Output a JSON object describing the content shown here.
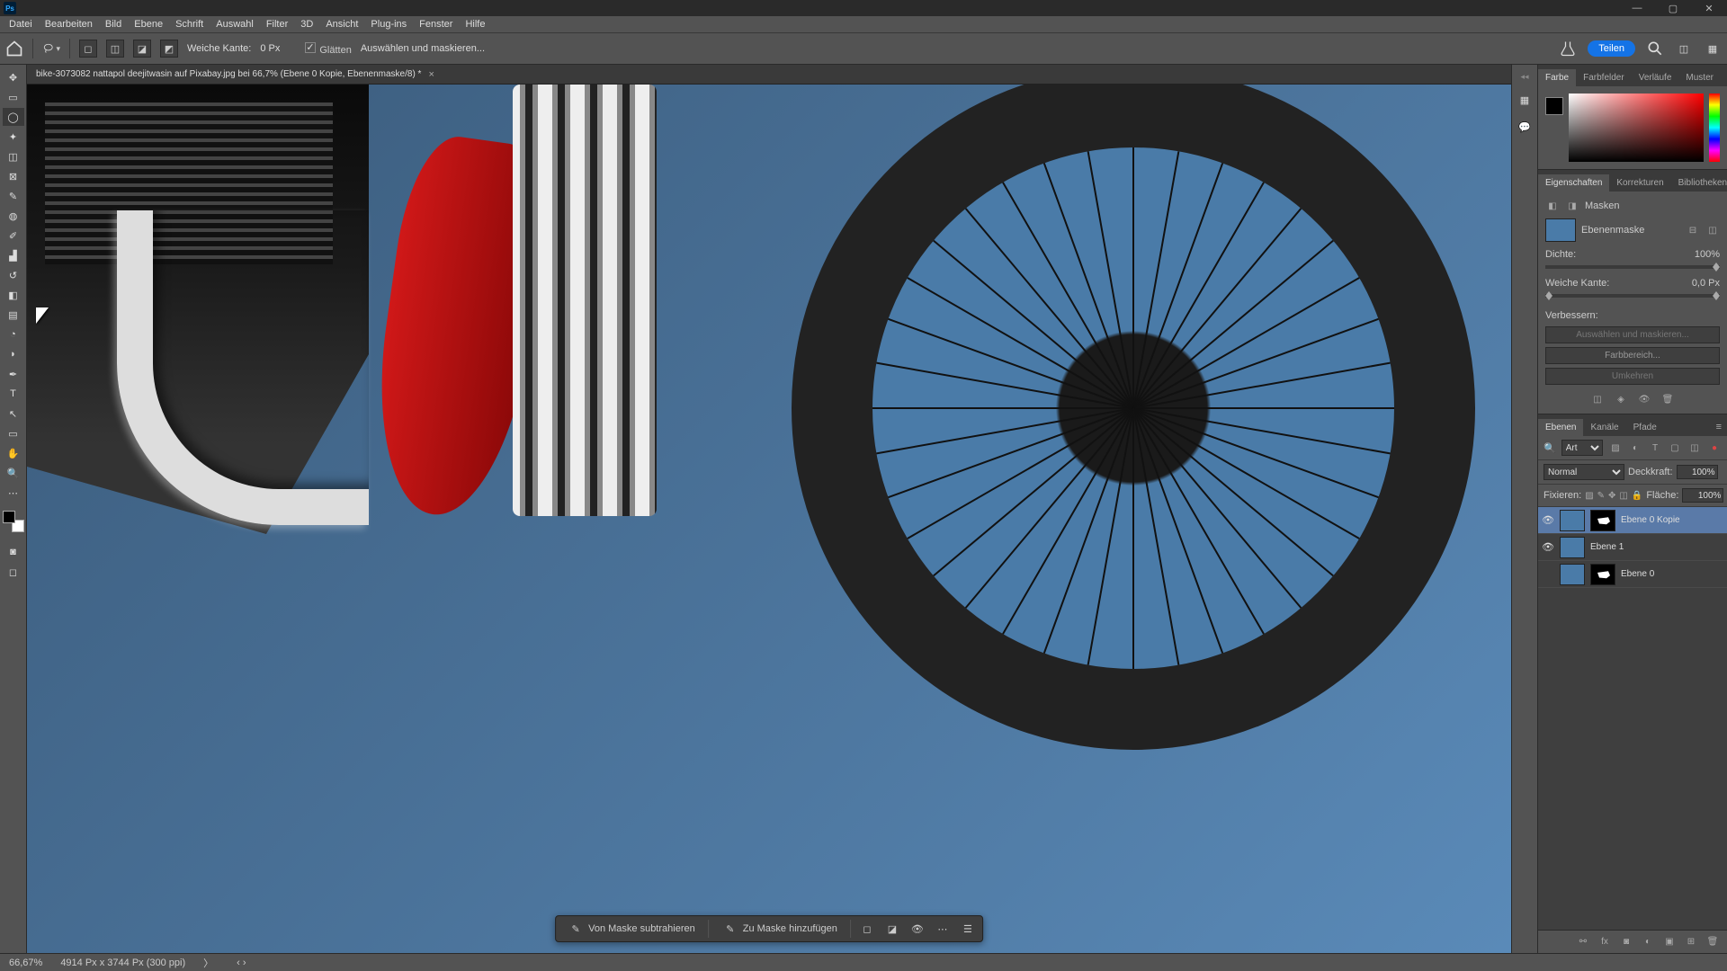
{
  "app": {
    "abbr": "Ps"
  },
  "window_controls": {
    "min": "—",
    "max": "▢",
    "close": "✕"
  },
  "menu": [
    "Datei",
    "Bearbeiten",
    "Bild",
    "Ebene",
    "Schrift",
    "Auswahl",
    "Filter",
    "3D",
    "Ansicht",
    "Plug-ins",
    "Fenster",
    "Hilfe"
  ],
  "optbar": {
    "weiche_kante_label": "Weiche Kante:",
    "weiche_kante_value": "0 Px",
    "glaetten_label": "Glätten",
    "select_mask": "Auswählen und maskieren...",
    "share": "Teilen"
  },
  "doc": {
    "tab_title": "bike-3073082 nattapol deejitwasin auf Pixabay.jpg bei 66,7% (Ebene 0 Kopie, Ebenenmaske/8) *"
  },
  "floatbar": {
    "subtract": "Von Maske subtrahieren",
    "add": "Zu Maske hinzufügen"
  },
  "panels": {
    "color_tabs": [
      "Farbe",
      "Farbfelder",
      "Verläufe",
      "Muster"
    ],
    "prop_tabs": [
      "Eigenschaften",
      "Korrekturen",
      "Bibliotheken"
    ],
    "masks_label": "Masken",
    "layermask_label": "Ebenenmaske",
    "dichte_label": "Dichte:",
    "dichte_value": "100%",
    "weiche_label": "Weiche Kante:",
    "weiche_value": "0,0 Px",
    "verbessern_label": "Verbessern:",
    "btn_auswaehlen": "Auswählen und maskieren...",
    "btn_farbbereich": "Farbbereich...",
    "btn_umkehren": "Umkehren",
    "layer_tabs": [
      "Ebenen",
      "Kanäle",
      "Pfade"
    ],
    "filter_kind": "Art",
    "blend_mode": "Normal",
    "opacity_label": "Deckkraft:",
    "opacity_value": "100%",
    "lock_label": "Fixieren:",
    "fill_label": "Fläche:",
    "fill_value": "100%",
    "layers": [
      {
        "name": "Ebene 0 Kopie",
        "visible": true,
        "mask": true,
        "selected": true
      },
      {
        "name": "Ebene 1",
        "visible": true,
        "mask": false,
        "selected": false
      },
      {
        "name": "Ebene 0",
        "visible": false,
        "mask": true,
        "selected": false
      }
    ]
  },
  "search_placeholder": "Art",
  "status": {
    "zoom": "66,67%",
    "dims": "4914 Px x 3744 Px (300 ppi)"
  }
}
